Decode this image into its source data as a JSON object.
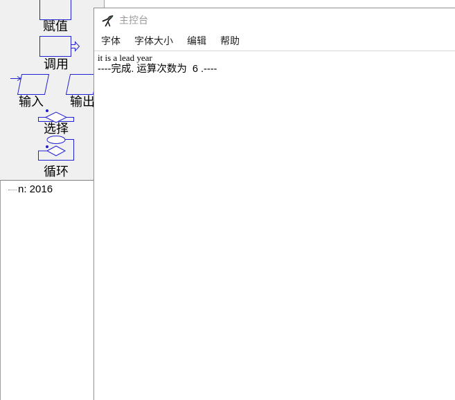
{
  "colors": {
    "symbol_stroke": "#2020d0",
    "palette_bg": "#f0f0f0",
    "title_text": "#999999",
    "menu_text": "#222222"
  },
  "toolbox": {
    "items": [
      {
        "label": "赋值",
        "icon": "assignment-rectangle-icon"
      },
      {
        "label": "调用",
        "icon": "call-rectangle-arrow-icon"
      },
      {
        "label": "输入",
        "icon": "input-parallelogram-icon"
      },
      {
        "label": "输出",
        "icon": "output-parallelogram-icon"
      },
      {
        "label": "选择",
        "icon": "selection-diamond-icon"
      },
      {
        "label": "循环",
        "icon": "loop-oval-diamond-icon"
      }
    ]
  },
  "watch": {
    "items": [
      {
        "label": "n: 2016"
      }
    ]
  },
  "console": {
    "icon": "raptor-icon",
    "title": "主控台",
    "menu": [
      "字体",
      "字体大小",
      "编辑",
      "帮助"
    ],
    "lines": [
      "it is a lead year",
      "----完成. 运算次数为  6 .----"
    ]
  }
}
